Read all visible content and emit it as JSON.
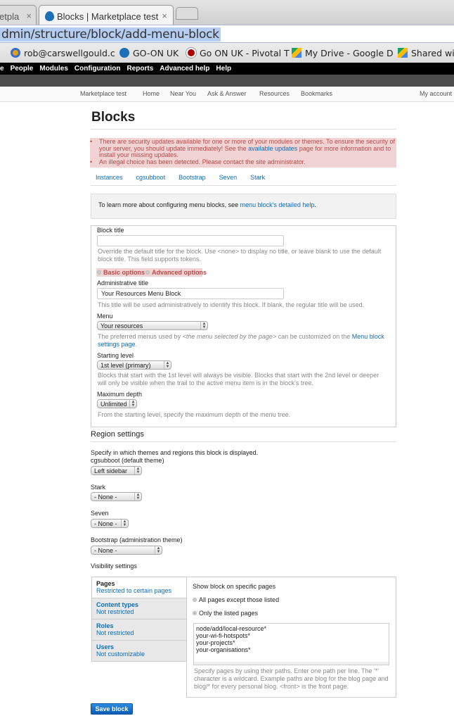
{
  "browser": {
    "tabs": [
      {
        "label": "etpla",
        "active": false
      },
      {
        "label": "Blocks | Marketplace test",
        "active": true
      }
    ],
    "url": "dmin/structure/block/add-menu-block",
    "bookmarks": [
      {
        "label": "rob@carswellgould.c",
        "icon": "gear-icon"
      },
      {
        "label": "GO-ON UK",
        "icon": "drupal-icon"
      },
      {
        "label": "Go ON UK - Pivotal T",
        "icon": "pivotal-icon"
      },
      {
        "label": "My Drive - Google D",
        "icon": "google-drive-icon"
      },
      {
        "label": "Shared wit",
        "icon": "google-drive-icon"
      }
    ]
  },
  "admin_menu": [
    "e",
    "People",
    "Modules",
    "Configuration",
    "Reports",
    "Advanced help",
    "Help"
  ],
  "site_nav": {
    "site_name": "Marketplace test",
    "items": [
      "Home",
      "Near You",
      "Ask & Answer",
      "Resources",
      "Bookmarks"
    ],
    "account": "My account"
  },
  "page": {
    "title": "Blocks",
    "messages": [
      {
        "before": "There are security updates available for one or more of your modules or themes. To ensure the security of your server, you should update immediately! See the ",
        "link": "available updates",
        "after": " page for more information and to install your missing updates."
      },
      {
        "before": "An illegal choice has been detected. Please contact the site administrator.",
        "link": "",
        "after": ""
      }
    ],
    "theme_tabs": [
      "Instances",
      "cgsubboot",
      "Bootstrap",
      "Seven",
      "Stark"
    ],
    "help": {
      "before": "To learn more about configuring menu blocks, see ",
      "link": "menu block's detailed help",
      "after": "."
    }
  },
  "form": {
    "block_title": {
      "label": "Block title",
      "value": "",
      "desc": "Override the default title for the block. Use <none> to display no title, or leave blank to use the default block title. This field supports tokens."
    },
    "options": {
      "basic": "Basic options",
      "advanced": "Advanced options"
    },
    "admin_title": {
      "label": "Administrative title",
      "value": "Your Resources Menu Block",
      "desc": "This title will be used administratively to identify this block. If blank, the regular title will be used."
    },
    "menu": {
      "label": "Menu",
      "value": "Your resources",
      "desc_before": "The preferred menus used by ",
      "desc_em": "<the menu selected by the page>",
      "desc_mid": " can be customized on the ",
      "desc_link": "Menu block settings page",
      "desc_after": "."
    },
    "starting_level": {
      "label": "Starting level",
      "value": "1st level (primary)",
      "desc": "Blocks that start with the 1st level will always be visible. Blocks that start with the 2nd level or deeper will only be visible when the trail to the active menu item is in the block's tree."
    },
    "max_depth": {
      "label": "Maximum depth",
      "value": "Unlimited",
      "desc": "From the starting level, specify the maximum depth of the menu tree."
    }
  },
  "region": {
    "heading": "Region settings",
    "desc": "Specify in which themes and regions this block is displayed.",
    "themes": [
      {
        "label": "cgsubboot (default theme)",
        "value": "Left sidebar"
      },
      {
        "label": "Stark",
        "value": "- None -"
      },
      {
        "label": "Seven",
        "value": "- None -"
      },
      {
        "label": "Bootstrap (administration theme)",
        "value": "- None -"
      }
    ]
  },
  "visibility": {
    "heading": "Visibility settings",
    "tabs": [
      {
        "title": "Pages",
        "summary": "Restricted to certain pages",
        "active": true
      },
      {
        "title": "Content types",
        "summary": "Not restricted"
      },
      {
        "title": "Roles",
        "summary": "Not restricted"
      },
      {
        "title": "Users",
        "summary": "Not customizable"
      }
    ],
    "pane_label": "Show block on specific pages",
    "radios": [
      {
        "label": "All pages except those listed",
        "checked": false
      },
      {
        "label": "Only the listed pages",
        "checked": true
      }
    ],
    "pages": "node/add/local-resource*\nyour-wi-fi-hotspots*\nyour-projects*\nyour-organisations*",
    "pages_desc": "Specify pages by using their paths. Enter one path per line. The '*' character is a wildcard. Example paths are blog for the blog page and blog/* for every personal blog. <front> is the front page."
  },
  "save_label": "Save block"
}
